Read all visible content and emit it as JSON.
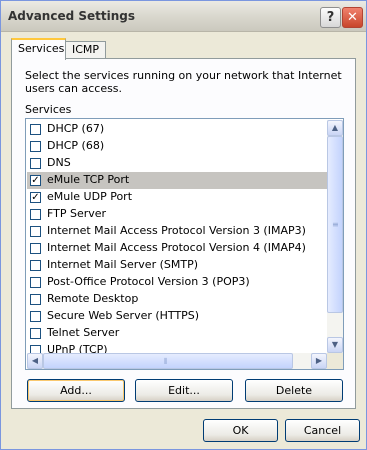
{
  "window": {
    "title": "Advanced Settings",
    "help_glyph": "?",
    "close_glyph": "✕"
  },
  "tabs": [
    {
      "label": "Services"
    },
    {
      "label": "ICMP"
    }
  ],
  "description": "Select the services running on your network that Internet users can access.",
  "services_label": "Services",
  "services": [
    {
      "label": "DHCP (67)",
      "checked": false
    },
    {
      "label": "DHCP (68)",
      "checked": false
    },
    {
      "label": "DNS",
      "checked": false
    },
    {
      "label": "eMule TCP Port",
      "checked": true,
      "selected": true
    },
    {
      "label": "eMule UDP Port",
      "checked": true
    },
    {
      "label": "FTP Server",
      "checked": false
    },
    {
      "label": "Internet Mail Access Protocol Version 3 (IMAP3)",
      "checked": false
    },
    {
      "label": "Internet Mail Access Protocol Version 4 (IMAP4)",
      "checked": false
    },
    {
      "label": "Internet Mail Server (SMTP)",
      "checked": false
    },
    {
      "label": "Post-Office Protocol Version 3 (POP3)",
      "checked": false
    },
    {
      "label": "Remote Desktop",
      "checked": false
    },
    {
      "label": "Secure Web Server (HTTPS)",
      "checked": false
    },
    {
      "label": "Telnet Server",
      "checked": false
    },
    {
      "label": "UPnP (TCP)",
      "checked": false
    }
  ],
  "buttons": {
    "add": "Add...",
    "edit": "Edit...",
    "delete": "Delete",
    "ok": "OK",
    "cancel": "Cancel"
  }
}
